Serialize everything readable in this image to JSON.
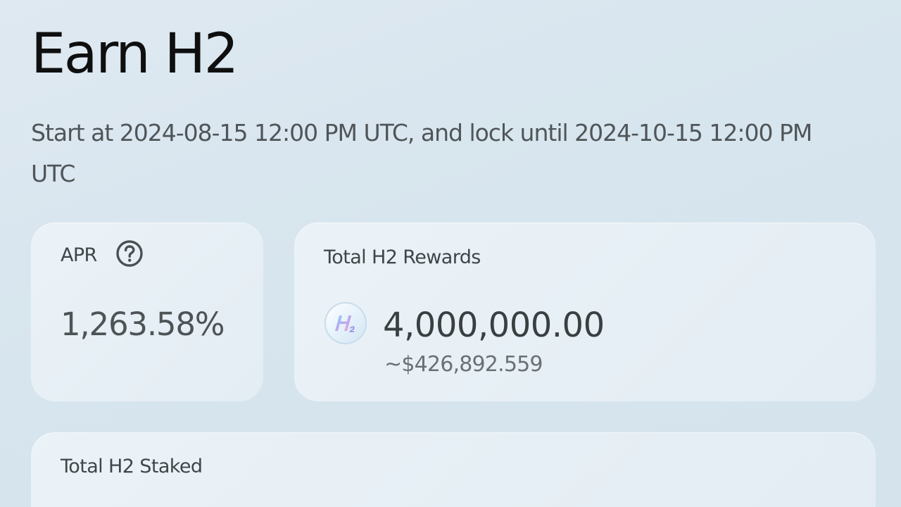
{
  "header": {
    "title": "Earn H2",
    "subtitle": "Start at 2024-08-15 12:00 PM UTC, and lock until 2024-10-15 12:00 PM UTC"
  },
  "apr_card": {
    "label": "APR",
    "help_icon": "question-circle-icon",
    "value": "1,263.58%"
  },
  "rewards_card": {
    "label": "Total H2 Rewards",
    "token_icon": "h2-token-logo",
    "amount": "4,000,000.00",
    "usd_value": "~$426,892.559"
  },
  "staked_card": {
    "label": "Total H2 Staked"
  },
  "colors": {
    "background": "#d9e6ef",
    "card": "#e8f0f5",
    "title": "#0f0f10",
    "text_secondary": "#4f5558"
  }
}
